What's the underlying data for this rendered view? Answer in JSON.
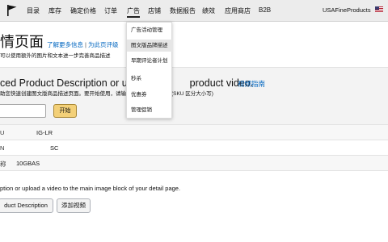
{
  "topnav": {
    "logo_icon": "flag-logo-icon",
    "items": [
      "目录",
      "库存",
      "确定价格",
      "订单",
      "广告",
      "店铺",
      "数据报告",
      "绩效",
      "应用商店",
      "B2B"
    ],
    "active_item": "广告",
    "store_name": "USAFineProducts",
    "flag_icon": "us-flag-icon"
  },
  "header": {
    "title": "情页面",
    "link_learn_more": "了解更多信息",
    "separator": "|",
    "link_rate_page": "为此页评级",
    "subtitle": "可以使用额外的图片和文本进一步完善商品描述"
  },
  "panel": {
    "heading": "ced Product Description or up",
    "heading_tail": "product video.",
    "heading_link": "视频指南",
    "description": "助您快速创建图文版商品描述页面。要开始使用，请输入您商品的 SKU。 (SKU 区分大小写)",
    "sku_input_value": "",
    "start_button": "开始"
  },
  "table": {
    "rows": [
      {
        "label": "U",
        "value": "IG-LR"
      },
      {
        "label": "N",
        "value": "SC"
      },
      {
        "label": "称",
        "value": "10GBAS"
      }
    ]
  },
  "bottom": {
    "description": "ption or upload a video to the main image block of your detail page.",
    "button_description": "duct Description",
    "button_add_video": "添加视频"
  },
  "dropdown": {
    "items": [
      "广告活动管理",
      "图文版品牌描述",
      "早期评论者计划",
      "秒杀",
      "优惠券",
      "管理促销"
    ],
    "highlighted_index": 1
  },
  "colors": {
    "link": "#0066c0",
    "start_button": "#f3d078",
    "nav_bg": "#ececec"
  }
}
